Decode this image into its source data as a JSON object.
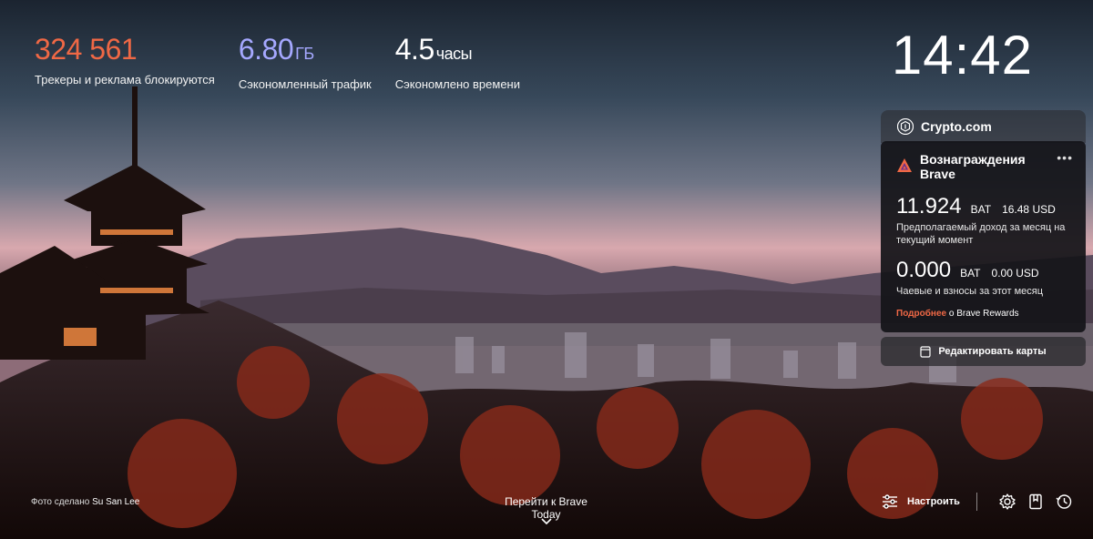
{
  "stats": {
    "trackers": {
      "value": "324 561",
      "label": "Трекеры и реклама блокируются"
    },
    "bandwidth": {
      "value": "6.80",
      "unit": "ГБ",
      "label": "Сэкономленный трафик"
    },
    "time": {
      "value": "4.5",
      "unit": "часы",
      "label": "Сэкономлено времени"
    }
  },
  "clock": "14:42",
  "widget": {
    "tab_label": "Crypto.com",
    "title": "Вознаграждения Brave",
    "more": "•••",
    "estimated": {
      "value": "11.924",
      "currency": "BAT",
      "usd": "16.48 USD",
      "label": "Предполагаемый доход за месяц на текущий момент"
    },
    "tips": {
      "value": "0.000",
      "currency": "BAT",
      "usd": "0.00 USD",
      "label": "Чаевые и взносы за этот месяц"
    },
    "learn_more": "Подробнее",
    "learn_rest": "о Brave Rewards"
  },
  "edit_cards": "Редактировать карты",
  "footer": {
    "credit_prefix": "Фото сделано",
    "credit_name": "Su San Lee",
    "brave_today": "Перейти к Brave Today",
    "customize": "Настроить"
  },
  "colors": {
    "accent": "#ef6845",
    "bandwidth": "#a5a8ff",
    "panel": "#141418"
  }
}
